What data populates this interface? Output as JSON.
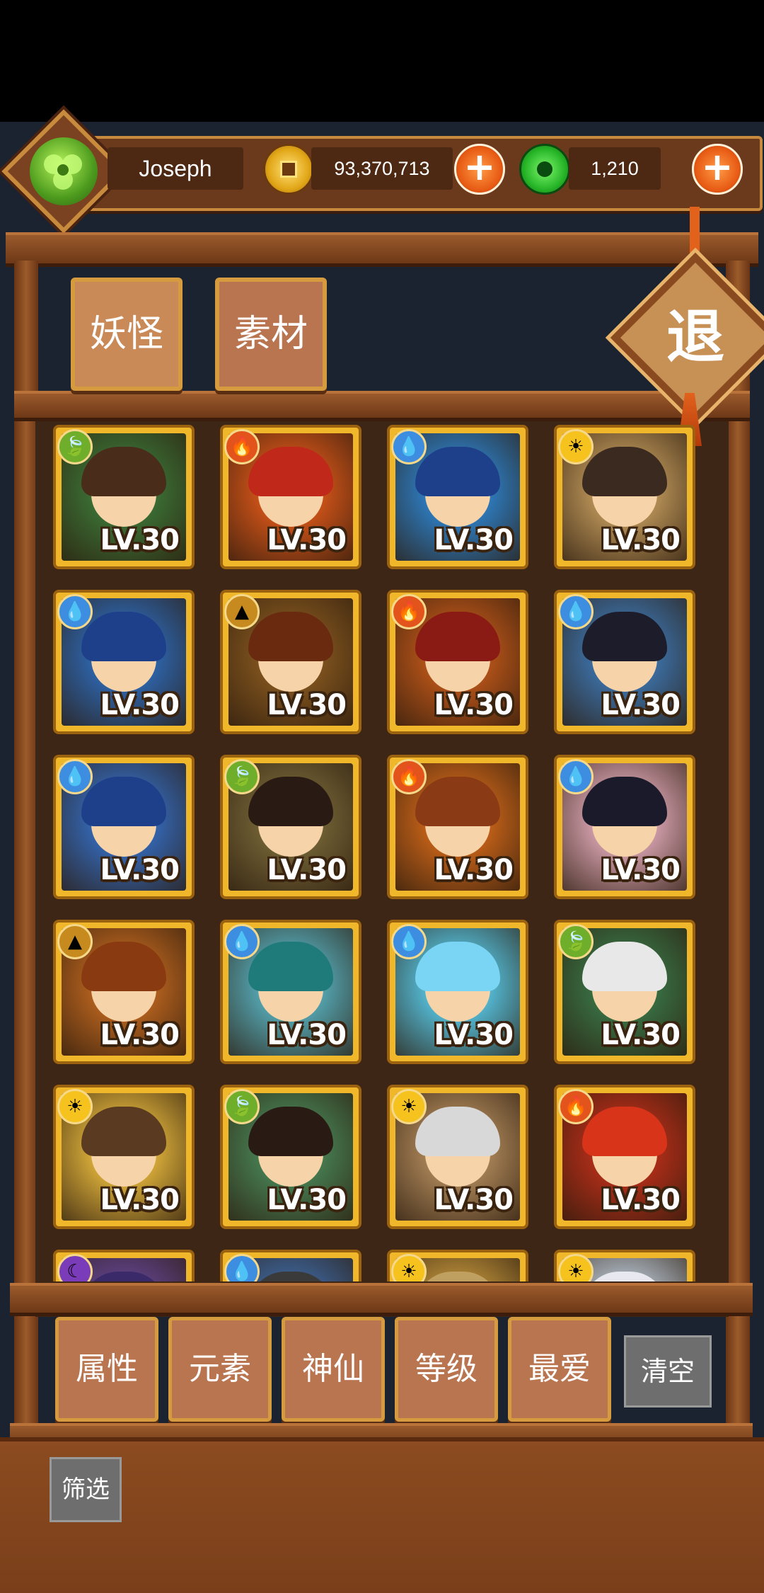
{
  "player": {
    "name": "Joseph"
  },
  "currency": {
    "gold": {
      "amount": "93,370,713",
      "icon": "gold-coin-icon"
    },
    "jade": {
      "amount": "1,210",
      "icon": "jade-coin-icon"
    }
  },
  "tabs": [
    {
      "label": "妖怪",
      "active": true
    },
    {
      "label": "素材",
      "active": false
    }
  ],
  "exit_label": "退",
  "monsters": [
    {
      "element": "wood",
      "level": "LV.30"
    },
    {
      "element": "fire",
      "level": "LV.30"
    },
    {
      "element": "water",
      "level": "LV.30"
    },
    {
      "element": "light",
      "level": "LV.30"
    },
    {
      "element": "water",
      "level": "LV.30"
    },
    {
      "element": "earth",
      "level": "LV.30"
    },
    {
      "element": "fire",
      "level": "LV.30"
    },
    {
      "element": "water",
      "level": "LV.30"
    },
    {
      "element": "water",
      "level": "LV.30"
    },
    {
      "element": "wood",
      "level": "LV.30"
    },
    {
      "element": "fire",
      "level": "LV.30"
    },
    {
      "element": "water",
      "level": "LV.30"
    },
    {
      "element": "earth",
      "level": "LV.30"
    },
    {
      "element": "water",
      "level": "LV.30"
    },
    {
      "element": "water",
      "level": "LV.30"
    },
    {
      "element": "wood",
      "level": "LV.30"
    },
    {
      "element": "light",
      "level": "LV.30"
    },
    {
      "element": "wood",
      "level": "LV.30"
    },
    {
      "element": "light",
      "level": "LV.30"
    },
    {
      "element": "fire",
      "level": "LV.30"
    },
    {
      "element": "dark",
      "level": ""
    },
    {
      "element": "water",
      "level": ""
    },
    {
      "element": "light",
      "level": ""
    },
    {
      "element": "light",
      "level": ""
    }
  ],
  "filters": [
    {
      "label": "属性"
    },
    {
      "label": "元素"
    },
    {
      "label": "神仙"
    },
    {
      "label": "等级"
    },
    {
      "label": "最爱"
    }
  ],
  "clear_label": "清空",
  "filter_label": "筛选",
  "colors": {
    "wood": "#6fae2a",
    "fire": "#e2541c",
    "water": "#3d8ee0",
    "light": "#f5c21e",
    "earth": "#c68a1e",
    "dark": "#7a3cb8"
  }
}
